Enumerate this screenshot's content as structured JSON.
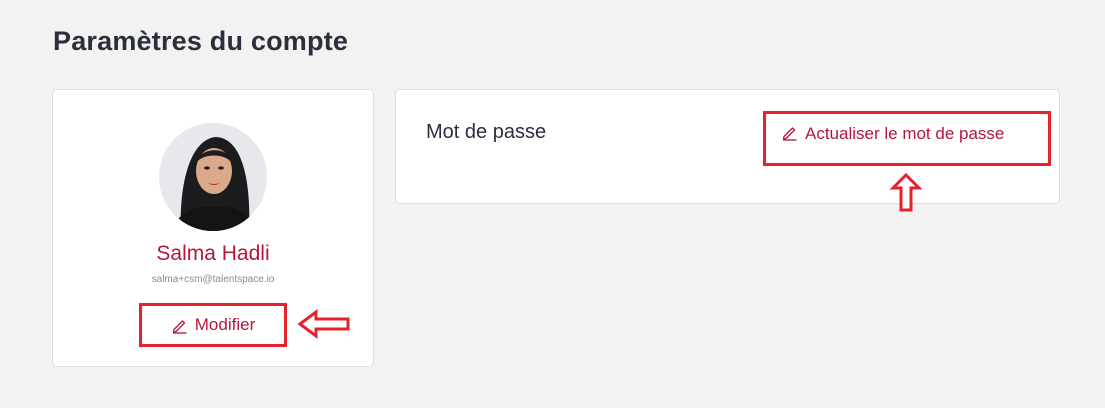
{
  "page": {
    "title": "Paramètres du compte"
  },
  "profile": {
    "name": "Salma Hadli",
    "email": "salma+csm@talentspace.io",
    "modify_label": "Modifier"
  },
  "password": {
    "section_label": "Mot de passe",
    "update_label": "Actualiser le mot de passe"
  },
  "colors": {
    "accent": "#b5173a",
    "highlight": "#e5212b",
    "title": "#2a2e3d",
    "background": "#f2f2f2"
  },
  "icons": {
    "edit": "pencil-icon",
    "annotation_left": "arrow-left-icon",
    "annotation_up": "arrow-up-icon"
  }
}
